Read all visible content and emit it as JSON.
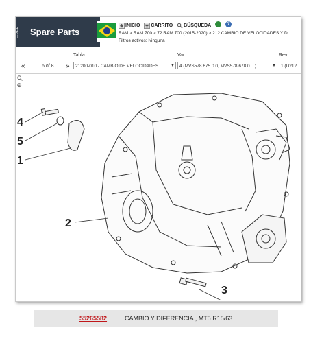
{
  "sidebar_brand": {
    "vertical_label": "E-PER",
    "title": "Spare Parts"
  },
  "nav": {
    "home_label": "INICIO",
    "cart_label": "CARRITO",
    "search_label": "BÚSQUEDA",
    "help_label": "?"
  },
  "breadcrumb": "RAM > RAM 700 > 72 RAM 700 (2015-2020) > 212 CAMBIO DE VELOCIDADES Y D",
  "filters": "Filtros activos: Ninguna",
  "columns": {
    "table": "Tabla",
    "var": "Var.",
    "rev": "Rev."
  },
  "pager": {
    "prev": "«",
    "text": "6 of 8",
    "next": "»"
  },
  "table_select": "21200-010 - CAMBIO DE VELOCIDADES",
  "var_select": "4 (MVS578.675.0.0, MVS578.678.0....)",
  "rev_select": "1 (D212",
  "callouts": [
    "4",
    "5",
    "1",
    "2",
    "3"
  ],
  "caption": {
    "part_number": "55265582",
    "description": "CAMBIO Y DIFERENCIA , MT5 R15/63"
  },
  "colors": {
    "brand_bg": "#2f3b4a",
    "part_link": "#c0171b",
    "caption_bg": "#e6e6e6"
  }
}
